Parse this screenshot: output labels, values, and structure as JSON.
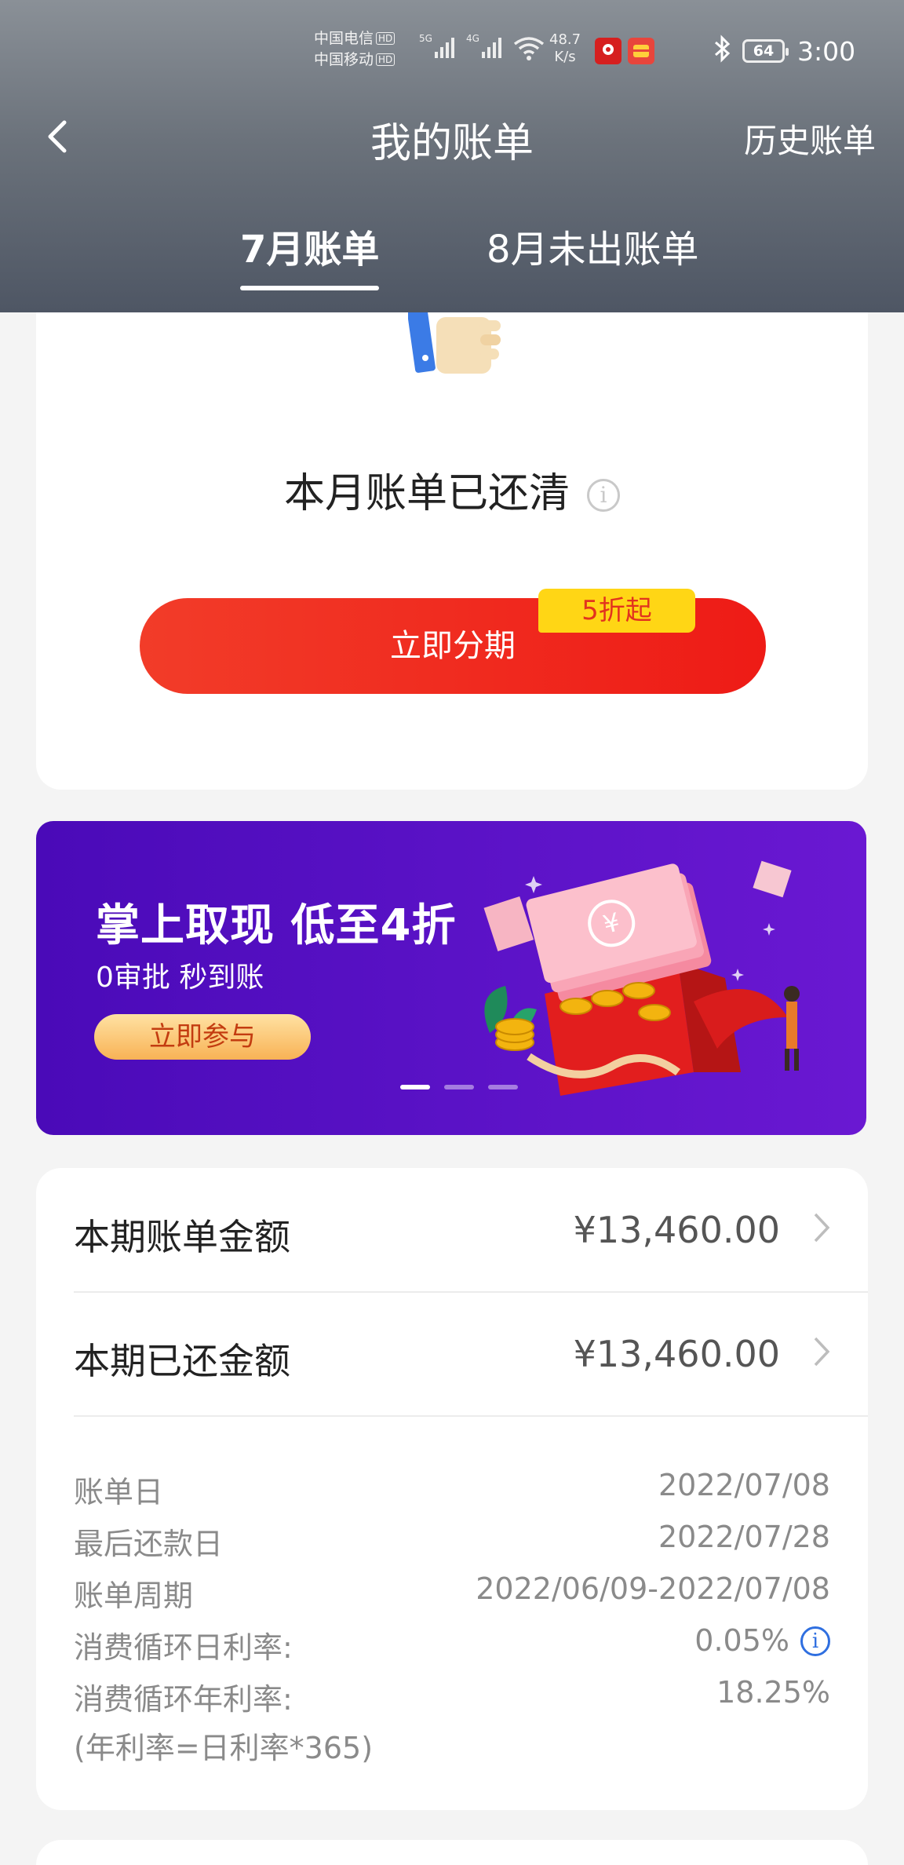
{
  "status_bar": {
    "carrier_1": "中国电信",
    "carrier_2": "中国移动",
    "hd": "HD",
    "sig_1_tag": "5G",
    "sig_2_tag": "4G",
    "net_speed": "48.7",
    "net_unit": "K/s",
    "battery": "64",
    "time": "3:00"
  },
  "nav": {
    "title": "我的账单",
    "history": "历史账单"
  },
  "tabs": [
    {
      "label": "7月账单",
      "active": true
    },
    {
      "label": "8月未出账单",
      "active": false
    }
  ],
  "status_card": {
    "message": "本月账单已还清",
    "info_glyph": "i",
    "installment_button": "立即分期",
    "promo_badge": "5折起"
  },
  "banner": {
    "headline": "掌上取现 低至4折",
    "subline": "0审批  秒到账",
    "cta": "立即参与",
    "coin_glyph": "¥",
    "slides": 3,
    "active_slide": 1
  },
  "bill": {
    "statement_amount_label": "本期账单金额",
    "statement_amount_value": "¥13,460.00",
    "repaid_amount_label": "本期已还金额",
    "repaid_amount_value": "¥13,460.00",
    "details": [
      {
        "key": "账单日",
        "value": "2022/07/08"
      },
      {
        "key": "最后还款日",
        "value": "2022/07/28"
      },
      {
        "key": "账单周期",
        "value": "2022/06/09-2022/07/08"
      },
      {
        "key": "消费循环日利率:",
        "value": "0.05%"
      },
      {
        "key": "消费循环年利率:",
        "value": "18.25%"
      }
    ],
    "info_glyph": "i",
    "note": "(年利率=日利率*365)"
  },
  "colors": {
    "header_top": "#8a9097",
    "header_bottom": "#4e5664",
    "primary_red": "#ee1b16",
    "badge_yellow": "#ffd615",
    "banner_purple": "#5a12c6",
    "info_blue": "#2f6fe0"
  }
}
